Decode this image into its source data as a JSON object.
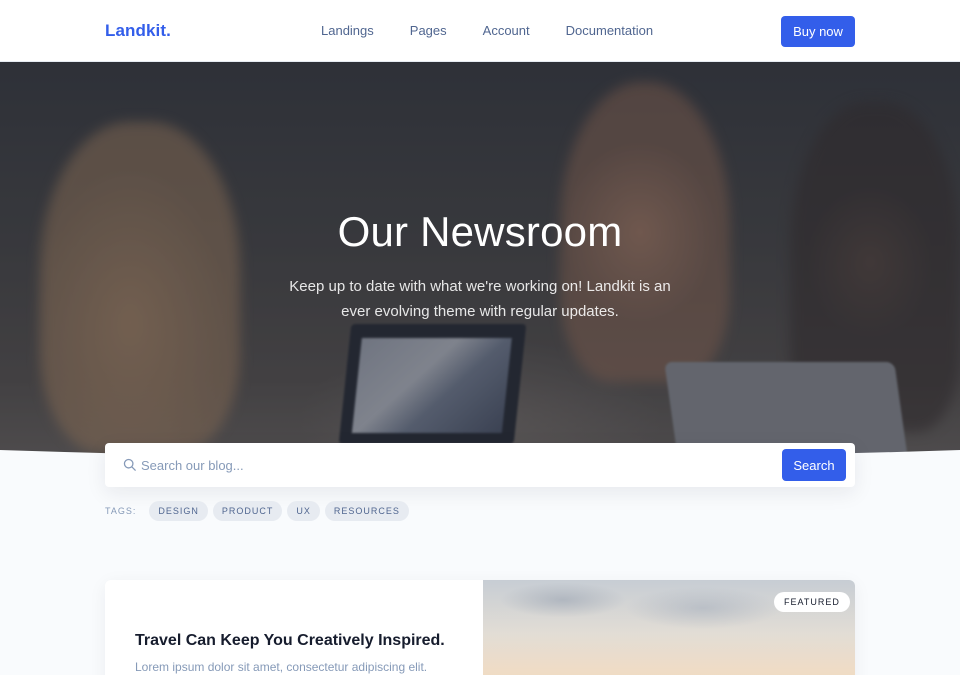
{
  "navbar": {
    "brand": "Landkit.",
    "links": [
      "Landings",
      "Pages",
      "Account",
      "Documentation"
    ],
    "cta_label": "Buy now"
  },
  "hero": {
    "title": "Our Newsroom",
    "subtitle_line1": "Keep up to date with what we're working on! Landkit is an",
    "subtitle_line2": "ever evolving theme with regular updates."
  },
  "search": {
    "placeholder": "Search our blog...",
    "value": "",
    "button_label": "Search",
    "icon": "search-icon"
  },
  "tags": {
    "label": "TAGS:",
    "items": [
      "DESIGN",
      "PRODUCT",
      "UX",
      "RESOURCES"
    ]
  },
  "featured_post": {
    "badge": "FEATURED",
    "title": "Travel Can Keep You Creatively Inspired.",
    "excerpt": "Lorem ipsum dolor sit amet, consectetur adipiscing elit."
  },
  "colors": {
    "primary": "#335eea",
    "text_dark": "#161c2d",
    "text_muted": "#869ab8",
    "page_bg": "#f9fbfd"
  }
}
